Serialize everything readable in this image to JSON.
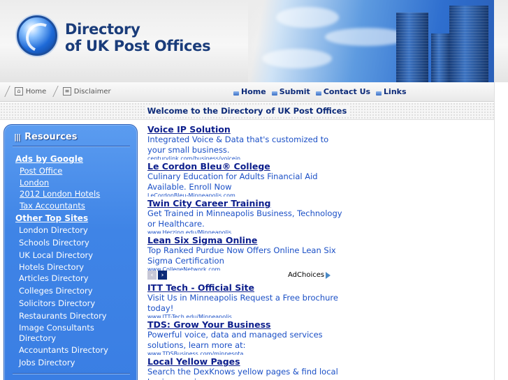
{
  "header": {
    "title_line1": "Directory",
    "title_line2": "of UK Post Offices"
  },
  "nav": {
    "left": [
      {
        "label": "Home",
        "icon": "home-icon"
      },
      {
        "label": "Disclaimer",
        "icon": "document-icon"
      }
    ],
    "right": [
      "Home",
      "Submit",
      "Contact Us",
      "Links"
    ]
  },
  "welcome": "Welcome to the Directory of UK Post Offices",
  "sidebar": {
    "heading": "Resources",
    "ads_heading": "Ads by Google",
    "ads_links": [
      "Post Office",
      "London",
      "2012 London Hotels",
      "Tax Accountants"
    ],
    "other_heading": "Other Top Sites",
    "directories": [
      "London Directory",
      "Schools Directory",
      "UK Local Directory",
      "Hotels Directory",
      "Articles Directory",
      "Colleges Directory",
      "Solicitors Directory",
      "Restaurants Directory",
      "Image Consultants Directory",
      "Accountants Directory",
      "Jobs Directory"
    ]
  },
  "ads": [
    {
      "title": "Voice IP Solution",
      "desc": "Integrated Voice & Data that's customized to your small business.",
      "url": "centurylink.com/business/voicein"
    },
    {
      "title": "Le Cordon Bleu® College",
      "desc": "Culinary Education for Adults Financial Aid Available. Enroll Now",
      "url": "LeCordonBleu-Minneapolis.com"
    },
    {
      "title": "Twin City Career Training",
      "desc": "Get Trained in Minneapolis Business, Technology or Healthcare.",
      "url": "www.Herzing.edu/Minneapolis"
    },
    {
      "title": "Lean Six Sigma Online",
      "desc": "Top Ranked Purdue Now Offers Online Lean Six Sigma Certification",
      "url": "www.CollegeNetwork.com"
    },
    {
      "title": "ITT Tech - Official Site",
      "desc": "Visit Us in Minneapolis Request a Free brochure today!",
      "url": "www.ITT-Tech.edu/Minneapolis"
    },
    {
      "title": "TDS: Grow Your Business",
      "desc": "Powerful voice, data and managed services solutions, learn more at:",
      "url": "www.TDSBusiness.com/minnesota"
    },
    {
      "title": "Local Yellow Pages",
      "desc": "Search the DexKnows yellow pages & find local businesses in your area.",
      "url": ""
    }
  ],
  "adchoices": "AdChoices",
  "colors": {
    "brand_blue": "#0c2a78",
    "sidebar_blue": "#3f84e6",
    "ad_link": "#1a4fc6"
  }
}
